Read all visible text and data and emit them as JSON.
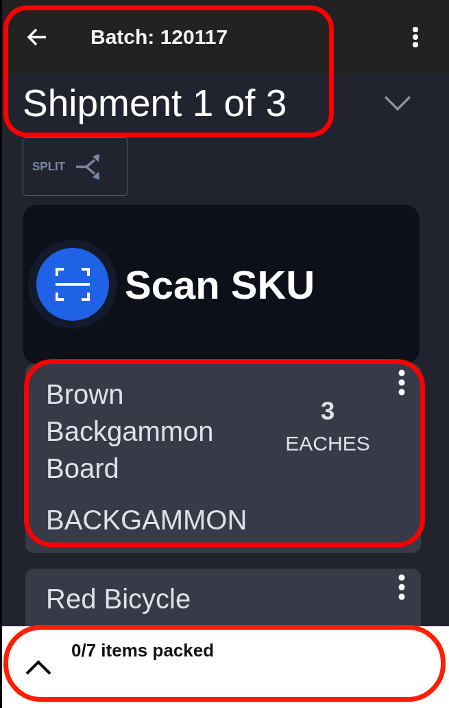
{
  "header": {
    "highlighted": true,
    "batch_title": "Batch: 120117",
    "shipment_title": "Shipment 1 of 3",
    "expanded": false
  },
  "split_button": {
    "label": "SPLIT"
  },
  "scan_prompt": {
    "label": "Scan SKU"
  },
  "items": [
    {
      "name": "Brown Backgammon Board",
      "quantity": "3",
      "unit": "EACHES",
      "sku": "BACKGAMMON",
      "highlighted": true
    },
    {
      "name": "Red Bicycle",
      "highlighted": false
    }
  ],
  "status_bar": {
    "text": "0/7 items packed",
    "expanded": false,
    "highlighted": true
  }
}
